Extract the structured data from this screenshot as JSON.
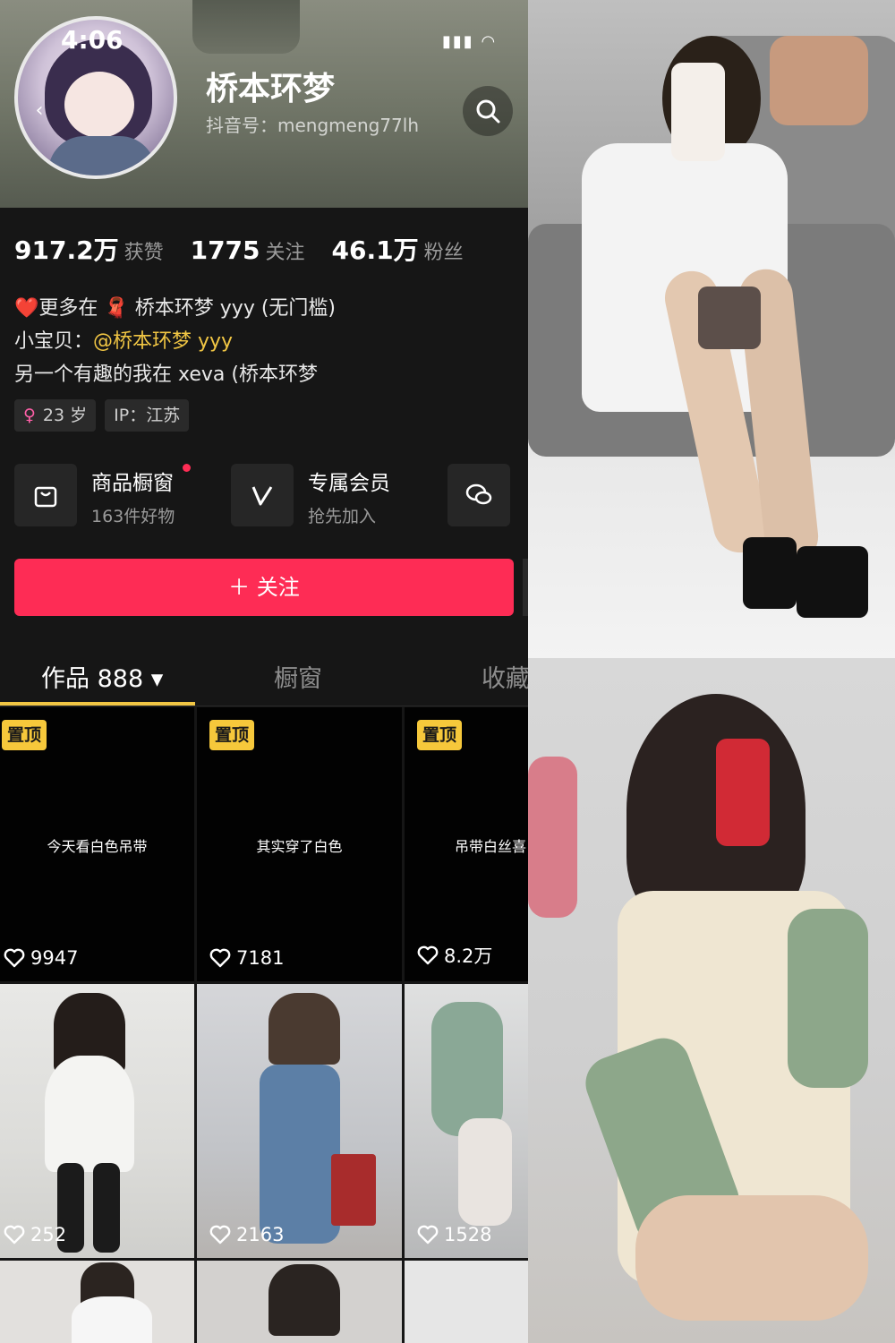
{
  "status_bar": {
    "time": "4:06",
    "icons": [
      "signal-icon",
      "wifi-icon",
      "battery-icon"
    ]
  },
  "profile": {
    "name": "桥本环梦",
    "douyin_id": "抖音号：mengmeng77lh",
    "stats": [
      {
        "value": "917.2万",
        "label": "获赞"
      },
      {
        "value": "1775",
        "label": "关注"
      },
      {
        "value": "46.1万",
        "label": "粉丝"
      }
    ],
    "bio_lines": [
      {
        "prefix": "❤️更多在 🧣 ",
        "text": "桥本环梦 yyy (无门槛)"
      },
      {
        "prefix": "小宝贝：",
        "mention": "@桥本环梦 yyy"
      },
      {
        "text": "另一个有趣的我在 xeva (桥本环梦"
      }
    ],
    "tags": [
      {
        "icon": "♀",
        "text": "23 岁"
      },
      {
        "text": "IP：江苏"
      }
    ]
  },
  "features": [
    {
      "title": "商品橱窗",
      "subtitle": "163件好物",
      "icon": "shopping-bag-icon"
    },
    {
      "title": "专属会员",
      "subtitle": "抢先加入",
      "icon": "v-badge-icon"
    },
    {
      "title": "",
      "subtitle": "",
      "icon": "chat-bubble-icon"
    }
  ],
  "follow_button": "＋ 关注",
  "tabs": [
    {
      "label": "作品 888 ▾",
      "active": true
    },
    {
      "label": "橱窗",
      "active": false
    },
    {
      "label": "收藏",
      "active": false
    }
  ],
  "videos": [
    {
      "pinned": true,
      "pin_label": "置顶",
      "caption": "今天看白色吊带",
      "likes": "9947"
    },
    {
      "pinned": true,
      "pin_label": "置顶",
      "caption": "其实穿了白色",
      "likes": "7181"
    },
    {
      "pinned": true,
      "pin_label": "置顶",
      "caption": "吊带白丝喜",
      "likes": "8.2万"
    },
    {
      "pinned": false,
      "caption": "",
      "likes": "252"
    },
    {
      "pinned": false,
      "caption": "",
      "likes": "2163"
    },
    {
      "pinned": false,
      "caption": "",
      "likes": "1528"
    }
  ],
  "colors": {
    "accent": "#fe2c55",
    "pin": "#f6c83b",
    "mention": "#f1c644",
    "bg": "#161616"
  }
}
